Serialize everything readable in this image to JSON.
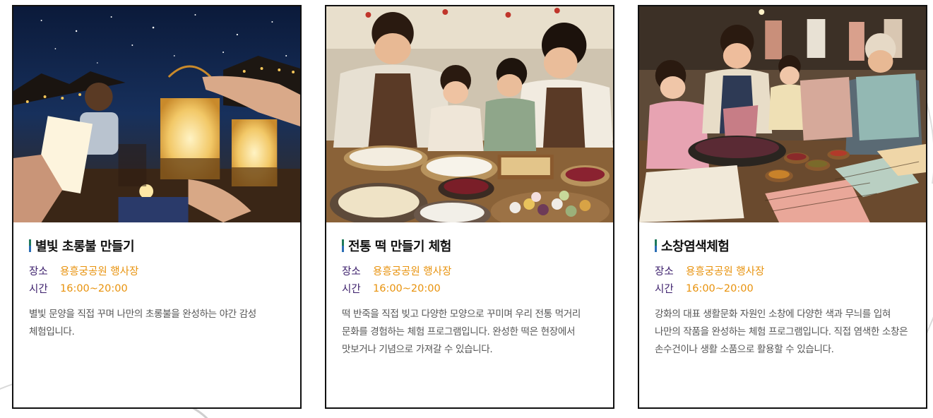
{
  "programs": [
    {
      "title": "별빛 초롱불 만들기",
      "place_label": "장소",
      "place": "용흥궁공원 행사장",
      "time_label": "시간",
      "time": "16:00~20:00",
      "description": "별빛 문양을 직접 꾸며 나만의 초롱불을 완성하는 야간 감성 체험입니다.",
      "image_alt": "밤하늘 아래 별빛 초롱불을 만드는 가족"
    },
    {
      "title": "전통 떡 만들기 체험",
      "place_label": "장소",
      "place": "용흥궁공원 행사장",
      "time_label": "시간",
      "time": "16:00~20:00",
      "description": "떡 반죽을 직접 빚고 다양한 모양으로 꾸미며 우리 전통 먹거리 문화를 경험하는 체험 프로그램입니다. 완성한 떡은 현장에서 맛보거나 기념으로 가져갈 수 있습니다.",
      "image_alt": "가족이 함께 전통 떡을 빚는 모습"
    },
    {
      "title": "소창염색체험",
      "place_label": "장소",
      "place": "용흥궁공원 행사장",
      "time_label": "시간",
      "time": "16:00~20:00",
      "description": "강화의 대표 생활문화 자원인 소창에 다양한 색과 무늬를 입혀 나만의 작품을 완성하는 체험 프로그램입니다. 직접 염색한 소창은 손수건이나 생활 소품으로 활용할 수 있습니다.",
      "image_alt": "소창 천을 염색하는 가족"
    }
  ],
  "colors": {
    "label": "#3b1e6b",
    "value": "#e8920c",
    "border": "#111111",
    "title_bar_green": "#1f7a5b",
    "title_bar_blue": "#2a6db5"
  }
}
